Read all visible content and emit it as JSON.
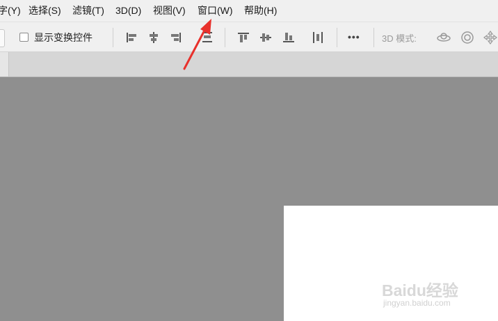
{
  "menubar": {
    "items": [
      {
        "label": "字(Y)"
      },
      {
        "label": "选择(S)"
      },
      {
        "label": "滤镜(T)"
      },
      {
        "label": "3D(D)"
      },
      {
        "label": "视图(V)"
      },
      {
        "label": "窗口(W)"
      },
      {
        "label": "帮助(H)"
      }
    ]
  },
  "options_bar": {
    "show_transform_controls": {
      "label": "显示变换控件",
      "checked": false
    },
    "more_label": "•••",
    "mode_label": "3D 模式:",
    "tools": [
      "align-left-edges-icon",
      "align-horizontal-centers-icon",
      "align-right-edges-icon",
      "distribute-vertical-icon",
      "align-top-edges-icon",
      "align-vertical-centers-icon",
      "align-bottom-edges-icon",
      "distribute-horizontal-icon",
      "orbit-3d-icon",
      "roll-3d-icon",
      "pan-3d-icon"
    ]
  },
  "annotation": {
    "arrow_color": "#e8312c",
    "points_to": "窗口(W)"
  },
  "watermark": {
    "text": "Baidu经验",
    "sub": "jingyan.baidu.com"
  },
  "colors": {
    "bar_bg": "#f0f0f0",
    "workspace_bg": "#8f8f8f",
    "document_bg": "#ffffff",
    "arrow": "#e8312c"
  }
}
